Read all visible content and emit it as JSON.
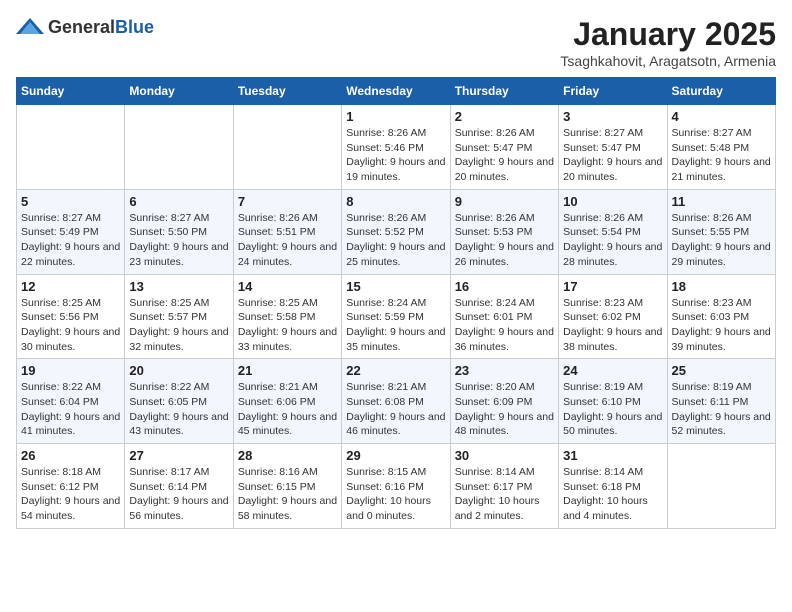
{
  "header": {
    "logo_general": "General",
    "logo_blue": "Blue",
    "month": "January 2025",
    "location": "Tsaghkahovit, Aragatsotn, Armenia"
  },
  "weekdays": [
    "Sunday",
    "Monday",
    "Tuesday",
    "Wednesday",
    "Thursday",
    "Friday",
    "Saturday"
  ],
  "weeks": [
    [
      {
        "day": "",
        "sunrise": "",
        "sunset": "",
        "daylight": ""
      },
      {
        "day": "",
        "sunrise": "",
        "sunset": "",
        "daylight": ""
      },
      {
        "day": "",
        "sunrise": "",
        "sunset": "",
        "daylight": ""
      },
      {
        "day": "1",
        "sunrise": "Sunrise: 8:26 AM",
        "sunset": "Sunset: 5:46 PM",
        "daylight": "Daylight: 9 hours and 19 minutes."
      },
      {
        "day": "2",
        "sunrise": "Sunrise: 8:26 AM",
        "sunset": "Sunset: 5:47 PM",
        "daylight": "Daylight: 9 hours and 20 minutes."
      },
      {
        "day": "3",
        "sunrise": "Sunrise: 8:27 AM",
        "sunset": "Sunset: 5:47 PM",
        "daylight": "Daylight: 9 hours and 20 minutes."
      },
      {
        "day": "4",
        "sunrise": "Sunrise: 8:27 AM",
        "sunset": "Sunset: 5:48 PM",
        "daylight": "Daylight: 9 hours and 21 minutes."
      }
    ],
    [
      {
        "day": "5",
        "sunrise": "Sunrise: 8:27 AM",
        "sunset": "Sunset: 5:49 PM",
        "daylight": "Daylight: 9 hours and 22 minutes."
      },
      {
        "day": "6",
        "sunrise": "Sunrise: 8:27 AM",
        "sunset": "Sunset: 5:50 PM",
        "daylight": "Daylight: 9 hours and 23 minutes."
      },
      {
        "day": "7",
        "sunrise": "Sunrise: 8:26 AM",
        "sunset": "Sunset: 5:51 PM",
        "daylight": "Daylight: 9 hours and 24 minutes."
      },
      {
        "day": "8",
        "sunrise": "Sunrise: 8:26 AM",
        "sunset": "Sunset: 5:52 PM",
        "daylight": "Daylight: 9 hours and 25 minutes."
      },
      {
        "day": "9",
        "sunrise": "Sunrise: 8:26 AM",
        "sunset": "Sunset: 5:53 PM",
        "daylight": "Daylight: 9 hours and 26 minutes."
      },
      {
        "day": "10",
        "sunrise": "Sunrise: 8:26 AM",
        "sunset": "Sunset: 5:54 PM",
        "daylight": "Daylight: 9 hours and 28 minutes."
      },
      {
        "day": "11",
        "sunrise": "Sunrise: 8:26 AM",
        "sunset": "Sunset: 5:55 PM",
        "daylight": "Daylight: 9 hours and 29 minutes."
      }
    ],
    [
      {
        "day": "12",
        "sunrise": "Sunrise: 8:25 AM",
        "sunset": "Sunset: 5:56 PM",
        "daylight": "Daylight: 9 hours and 30 minutes."
      },
      {
        "day": "13",
        "sunrise": "Sunrise: 8:25 AM",
        "sunset": "Sunset: 5:57 PM",
        "daylight": "Daylight: 9 hours and 32 minutes."
      },
      {
        "day": "14",
        "sunrise": "Sunrise: 8:25 AM",
        "sunset": "Sunset: 5:58 PM",
        "daylight": "Daylight: 9 hours and 33 minutes."
      },
      {
        "day": "15",
        "sunrise": "Sunrise: 8:24 AM",
        "sunset": "Sunset: 5:59 PM",
        "daylight": "Daylight: 9 hours and 35 minutes."
      },
      {
        "day": "16",
        "sunrise": "Sunrise: 8:24 AM",
        "sunset": "Sunset: 6:01 PM",
        "daylight": "Daylight: 9 hours and 36 minutes."
      },
      {
        "day": "17",
        "sunrise": "Sunrise: 8:23 AM",
        "sunset": "Sunset: 6:02 PM",
        "daylight": "Daylight: 9 hours and 38 minutes."
      },
      {
        "day": "18",
        "sunrise": "Sunrise: 8:23 AM",
        "sunset": "Sunset: 6:03 PM",
        "daylight": "Daylight: 9 hours and 39 minutes."
      }
    ],
    [
      {
        "day": "19",
        "sunrise": "Sunrise: 8:22 AM",
        "sunset": "Sunset: 6:04 PM",
        "daylight": "Daylight: 9 hours and 41 minutes."
      },
      {
        "day": "20",
        "sunrise": "Sunrise: 8:22 AM",
        "sunset": "Sunset: 6:05 PM",
        "daylight": "Daylight: 9 hours and 43 minutes."
      },
      {
        "day": "21",
        "sunrise": "Sunrise: 8:21 AM",
        "sunset": "Sunset: 6:06 PM",
        "daylight": "Daylight: 9 hours and 45 minutes."
      },
      {
        "day": "22",
        "sunrise": "Sunrise: 8:21 AM",
        "sunset": "Sunset: 6:08 PM",
        "daylight": "Daylight: 9 hours and 46 minutes."
      },
      {
        "day": "23",
        "sunrise": "Sunrise: 8:20 AM",
        "sunset": "Sunset: 6:09 PM",
        "daylight": "Daylight: 9 hours and 48 minutes."
      },
      {
        "day": "24",
        "sunrise": "Sunrise: 8:19 AM",
        "sunset": "Sunset: 6:10 PM",
        "daylight": "Daylight: 9 hours and 50 minutes."
      },
      {
        "day": "25",
        "sunrise": "Sunrise: 8:19 AM",
        "sunset": "Sunset: 6:11 PM",
        "daylight": "Daylight: 9 hours and 52 minutes."
      }
    ],
    [
      {
        "day": "26",
        "sunrise": "Sunrise: 8:18 AM",
        "sunset": "Sunset: 6:12 PM",
        "daylight": "Daylight: 9 hours and 54 minutes."
      },
      {
        "day": "27",
        "sunrise": "Sunrise: 8:17 AM",
        "sunset": "Sunset: 6:14 PM",
        "daylight": "Daylight: 9 hours and 56 minutes."
      },
      {
        "day": "28",
        "sunrise": "Sunrise: 8:16 AM",
        "sunset": "Sunset: 6:15 PM",
        "daylight": "Daylight: 9 hours and 58 minutes."
      },
      {
        "day": "29",
        "sunrise": "Sunrise: 8:15 AM",
        "sunset": "Sunset: 6:16 PM",
        "daylight": "Daylight: 10 hours and 0 minutes."
      },
      {
        "day": "30",
        "sunrise": "Sunrise: 8:14 AM",
        "sunset": "Sunset: 6:17 PM",
        "daylight": "Daylight: 10 hours and 2 minutes."
      },
      {
        "day": "31",
        "sunrise": "Sunrise: 8:14 AM",
        "sunset": "Sunset: 6:18 PM",
        "daylight": "Daylight: 10 hours and 4 minutes."
      },
      {
        "day": "",
        "sunrise": "",
        "sunset": "",
        "daylight": ""
      }
    ]
  ]
}
